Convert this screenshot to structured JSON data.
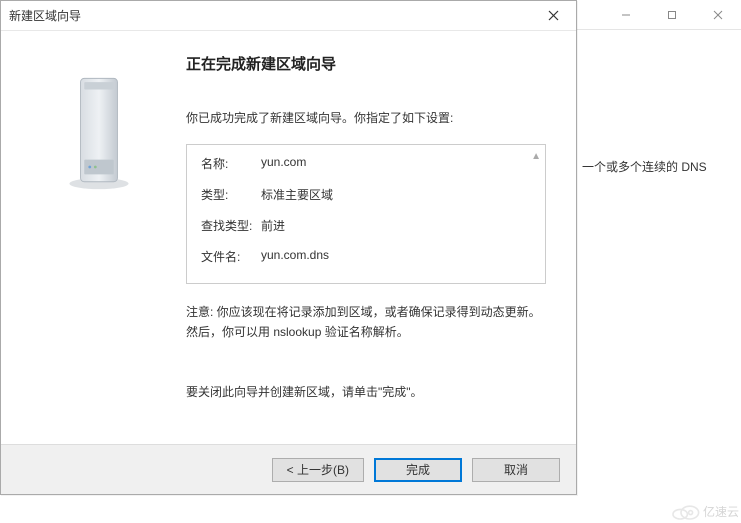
{
  "dialog": {
    "title": "新建区域向导",
    "heading": "正在完成新建区域向导",
    "intro": "你已成功完成了新建区域向导。你指定了如下设置:",
    "summary": {
      "name_label": "名称:",
      "name_value": "yun.com",
      "type_label": "类型:",
      "type_value": "标准主要区域",
      "lookup_label": "查找类型:",
      "lookup_value": "前进",
      "file_label": "文件名:",
      "file_value": "yun.com.dns"
    },
    "note": "注意: 你应该现在将记录添加到区域，或者确保记录得到动态更新。然后，你可以用 nslookup 验证名称解析。",
    "instruction": "要关闭此向导并创建新区域，请单击\"完成\"。",
    "buttons": {
      "back": "< 上一步(B)",
      "finish": "完成",
      "cancel": "取消"
    }
  },
  "background": {
    "partial_text": "一个或多个连续的 DNS"
  },
  "watermark": {
    "text": "亿速云"
  }
}
